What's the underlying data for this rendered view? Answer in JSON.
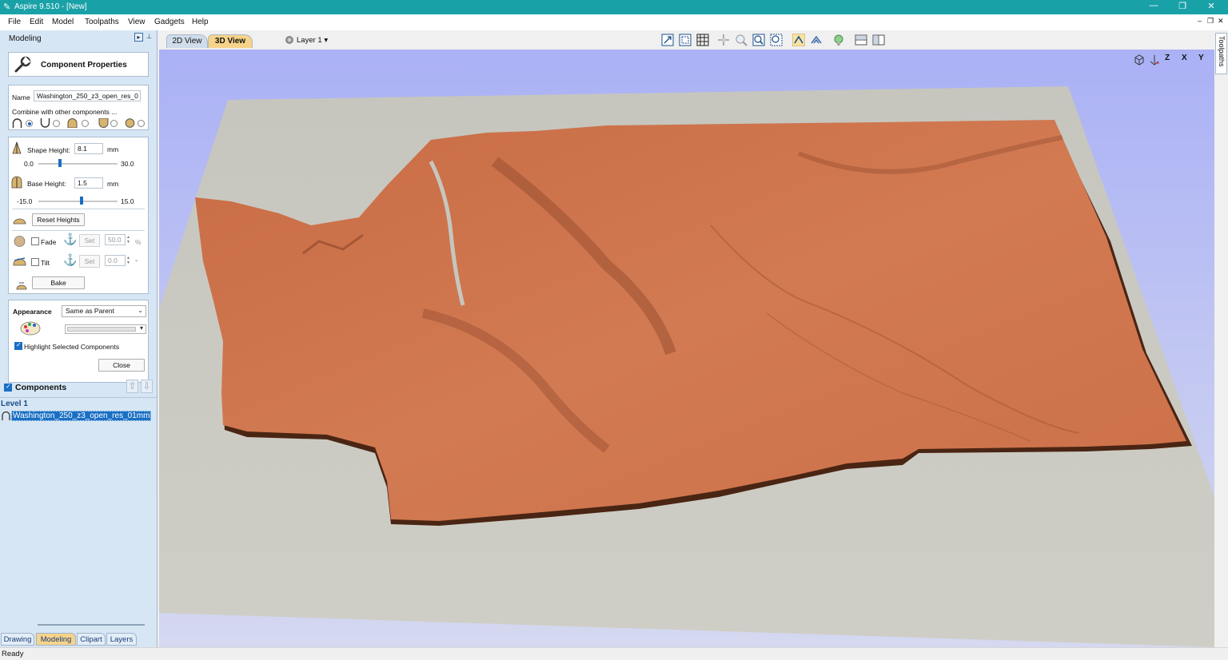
{
  "window": {
    "title": "Aspire 9.510 - [New]",
    "minimize_glyph": "—",
    "maximize_glyph": "❐",
    "close_glyph": "✕",
    "mdi_minimize_glyph": "–",
    "mdi_restore_glyph": "❐",
    "mdi_close_glyph": "✕"
  },
  "menu": [
    "File",
    "Edit",
    "Model",
    "Toolpaths",
    "View",
    "Gadgets",
    "Help"
  ],
  "left_panel": {
    "title": "Modeling",
    "component_properties_title": "Component Properties",
    "name_label": "Name",
    "name_value": "Washington_250_z3_open_res_0",
    "combine_label": "Combine with other components ...",
    "combine_mode_selected": "add",
    "shape_height_label": "Shape Height:",
    "shape_height_value": "8.1",
    "shape_height_unit": "mm",
    "shape_min": "0.0",
    "shape_max": "30.0",
    "shape_height_fraction": 0.27,
    "base_height_label": "Base Height:",
    "base_height_value": "1.5",
    "base_height_unit": "mm",
    "base_min": "-15.0",
    "base_max": "15.0",
    "base_height_fraction": 0.55,
    "reset_heights_label": "Reset Heights",
    "fade_label": "Fade",
    "fade_checked": false,
    "fade_set_label": "Set",
    "fade_value": "50.0",
    "fade_unit": "%",
    "tilt_label": "Tilt",
    "tilt_checked": false,
    "tilt_set_label": "Set",
    "tilt_value": "0.0",
    "tilt_unit": "°",
    "bake_label": "Bake",
    "appearance_label": "Appearance",
    "appearance_value": "Same as Parent",
    "highlight_label": "Highlight Selected Components",
    "highlight_checked": true,
    "close_label": "Close",
    "components_title": "Components",
    "components_checked": true,
    "level_label": "Level 1",
    "component_item": "Washington_250_z3_open_res_01mm"
  },
  "bottom_tabs": [
    "Drawing",
    "Modeling",
    "Clipart",
    "Layers"
  ],
  "active_bottom_tab": "Modeling",
  "view_tabs": [
    "2D View",
    "3D View"
  ],
  "active_view_tab": "3D View",
  "layer_label": "Layer 1 ▾",
  "axis_views": [
    "Z",
    "X",
    "Y"
  ],
  "right_tab": "Toolpaths",
  "status": "Ready",
  "colors": {
    "title_bar": "#19a1a8",
    "panel_bg": "#d7e6f4",
    "selection": "#1a6fc4",
    "model_copper": "#d07550",
    "model_plate": "#c8c7bd",
    "active_tab": "#f7d38a"
  },
  "icons": [
    "wrench-icon",
    "gear-icon",
    "anchor-icon",
    "palette-icon",
    "up-arrow-icon",
    "down-arrow-icon",
    "layer-icon"
  ]
}
